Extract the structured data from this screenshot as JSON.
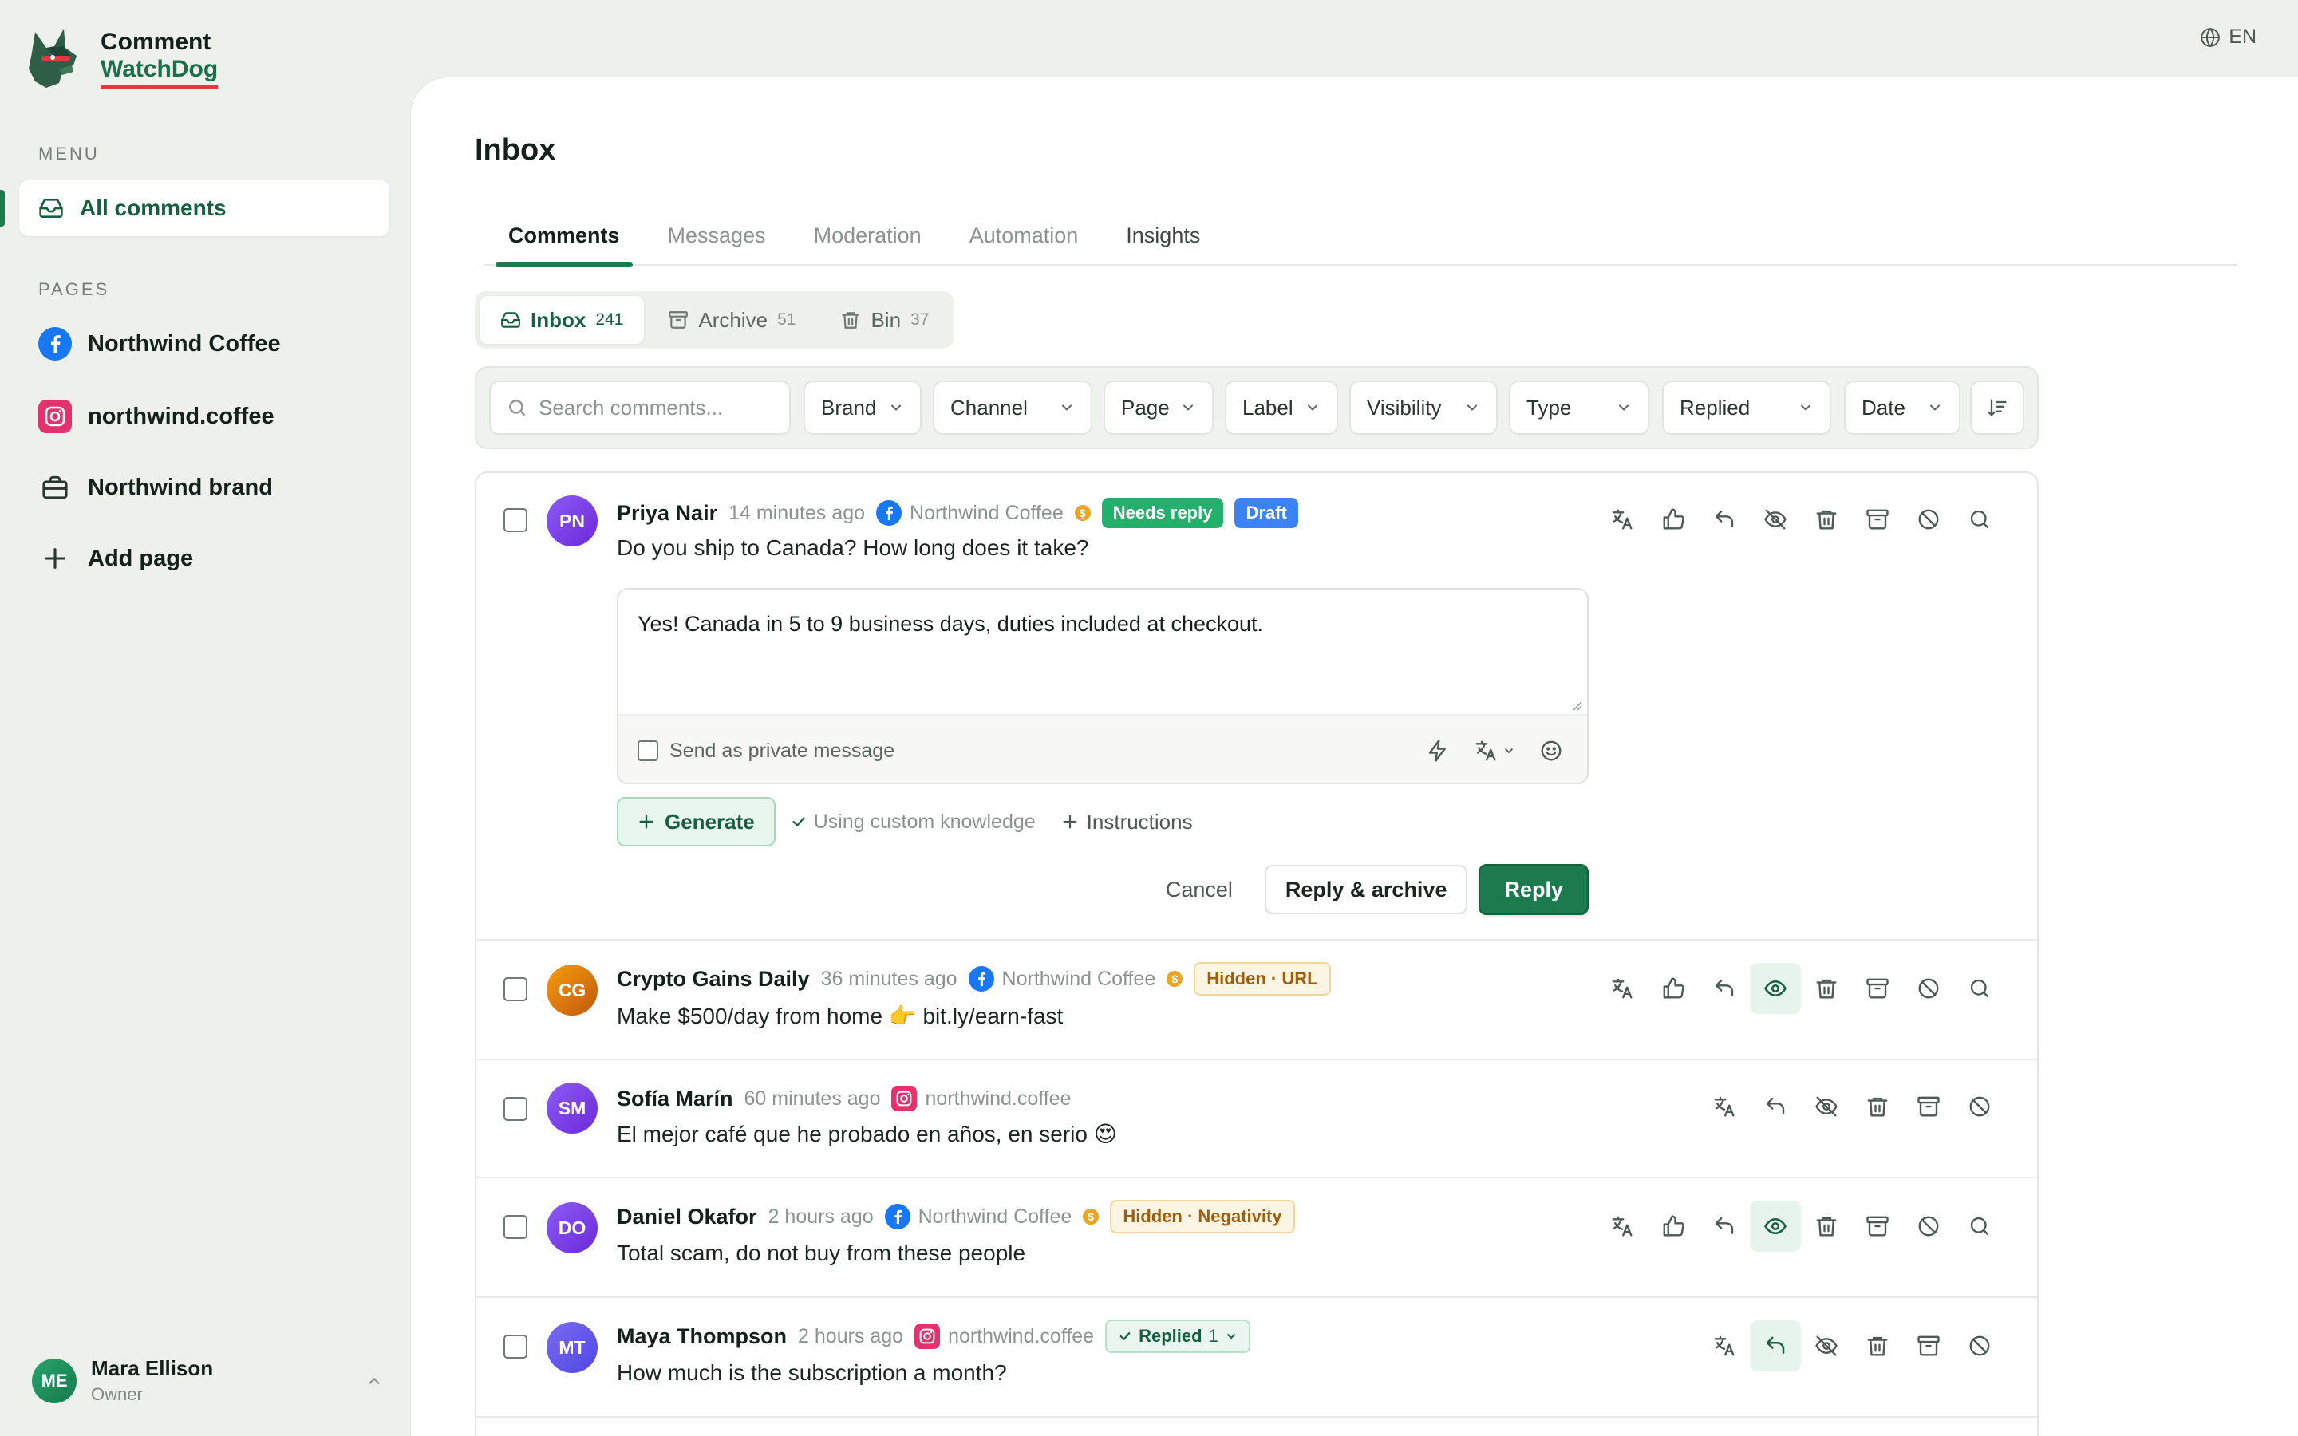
{
  "brand": {
    "line1": "Comment",
    "line2": "WatchDog"
  },
  "lang": "EN",
  "sidebar": {
    "menu_label": "MENU",
    "menu_items": [
      {
        "label": "All comments",
        "icon": "inbox-icon"
      }
    ],
    "pages_label": "PAGES",
    "pages": [
      {
        "label": "Northwind Coffee",
        "icon": "facebook-icon"
      },
      {
        "label": "northwind.coffee",
        "icon": "instagram-icon"
      },
      {
        "label": "Northwind brand",
        "icon": "briefcase-icon"
      }
    ],
    "add_page": "Add page",
    "user": {
      "initials": "ME",
      "name": "Mara Ellison",
      "role": "Owner"
    }
  },
  "main": {
    "title": "Inbox",
    "tabs": [
      "Comments",
      "Messages",
      "Moderation",
      "Automation",
      "Insights"
    ],
    "segments": [
      {
        "label": "Inbox",
        "count": "241"
      },
      {
        "label": "Archive",
        "count": "51"
      },
      {
        "label": "Bin",
        "count": "37"
      }
    ],
    "search_placeholder": "Search comments...",
    "filters": [
      "Brand",
      "Channel",
      "Page",
      "Label",
      "Visibility",
      "Type",
      "Replied",
      "Date"
    ]
  },
  "comments": [
    {
      "initials": "PN",
      "author": "Priya Nair",
      "time": "14 minutes ago",
      "page": "Northwind Coffee",
      "channel": "facebook",
      "badges": [
        "Needs reply",
        "Draft"
      ],
      "text": "Do you ship to Canada? How long does it take?",
      "reply": {
        "draft": "Yes! Canada in 5 to 9 business days, duties included at checkout.",
        "private_label": "Send as private message",
        "generate": "Generate",
        "knowledge": "Using custom knowledge",
        "instructions": "Instructions",
        "cancel": "Cancel",
        "reply_archive": "Reply & archive",
        "reply": "Reply"
      }
    },
    {
      "initials": "CG",
      "author": "Crypto Gains Daily",
      "time": "36 minutes ago",
      "page": "Northwind Coffee",
      "channel": "facebook",
      "badge": "Hidden · URL",
      "text": "Make $500/day from home 👉  bit.ly/earn-fast"
    },
    {
      "initials": "SM",
      "author": "Sofía Marín",
      "time": "60 minutes ago",
      "page": "northwind.coffee",
      "channel": "instagram",
      "text": "El mejor café que he probado en años, en serio 😍"
    },
    {
      "initials": "DO",
      "author": "Daniel Okafor",
      "time": "2 hours ago",
      "page": "Northwind Coffee",
      "channel": "facebook",
      "badge": "Hidden · Negativity",
      "text": "Total scam, do not buy from these people"
    },
    {
      "initials": "MT",
      "author": "Maya Thompson",
      "time": "2 hours ago",
      "page": "northwind.coffee",
      "channel": "instagram",
      "badge": "Replied",
      "badge_count": "1",
      "text": "How much is the subscription a month?"
    }
  ],
  "colors": {
    "accent": "#1c7a4e",
    "needs_reply": "#22b06c",
    "draft": "#3b82f6",
    "hidden": "#a15c08",
    "facebook": "#1877f2",
    "instagram": "#e4326f"
  }
}
